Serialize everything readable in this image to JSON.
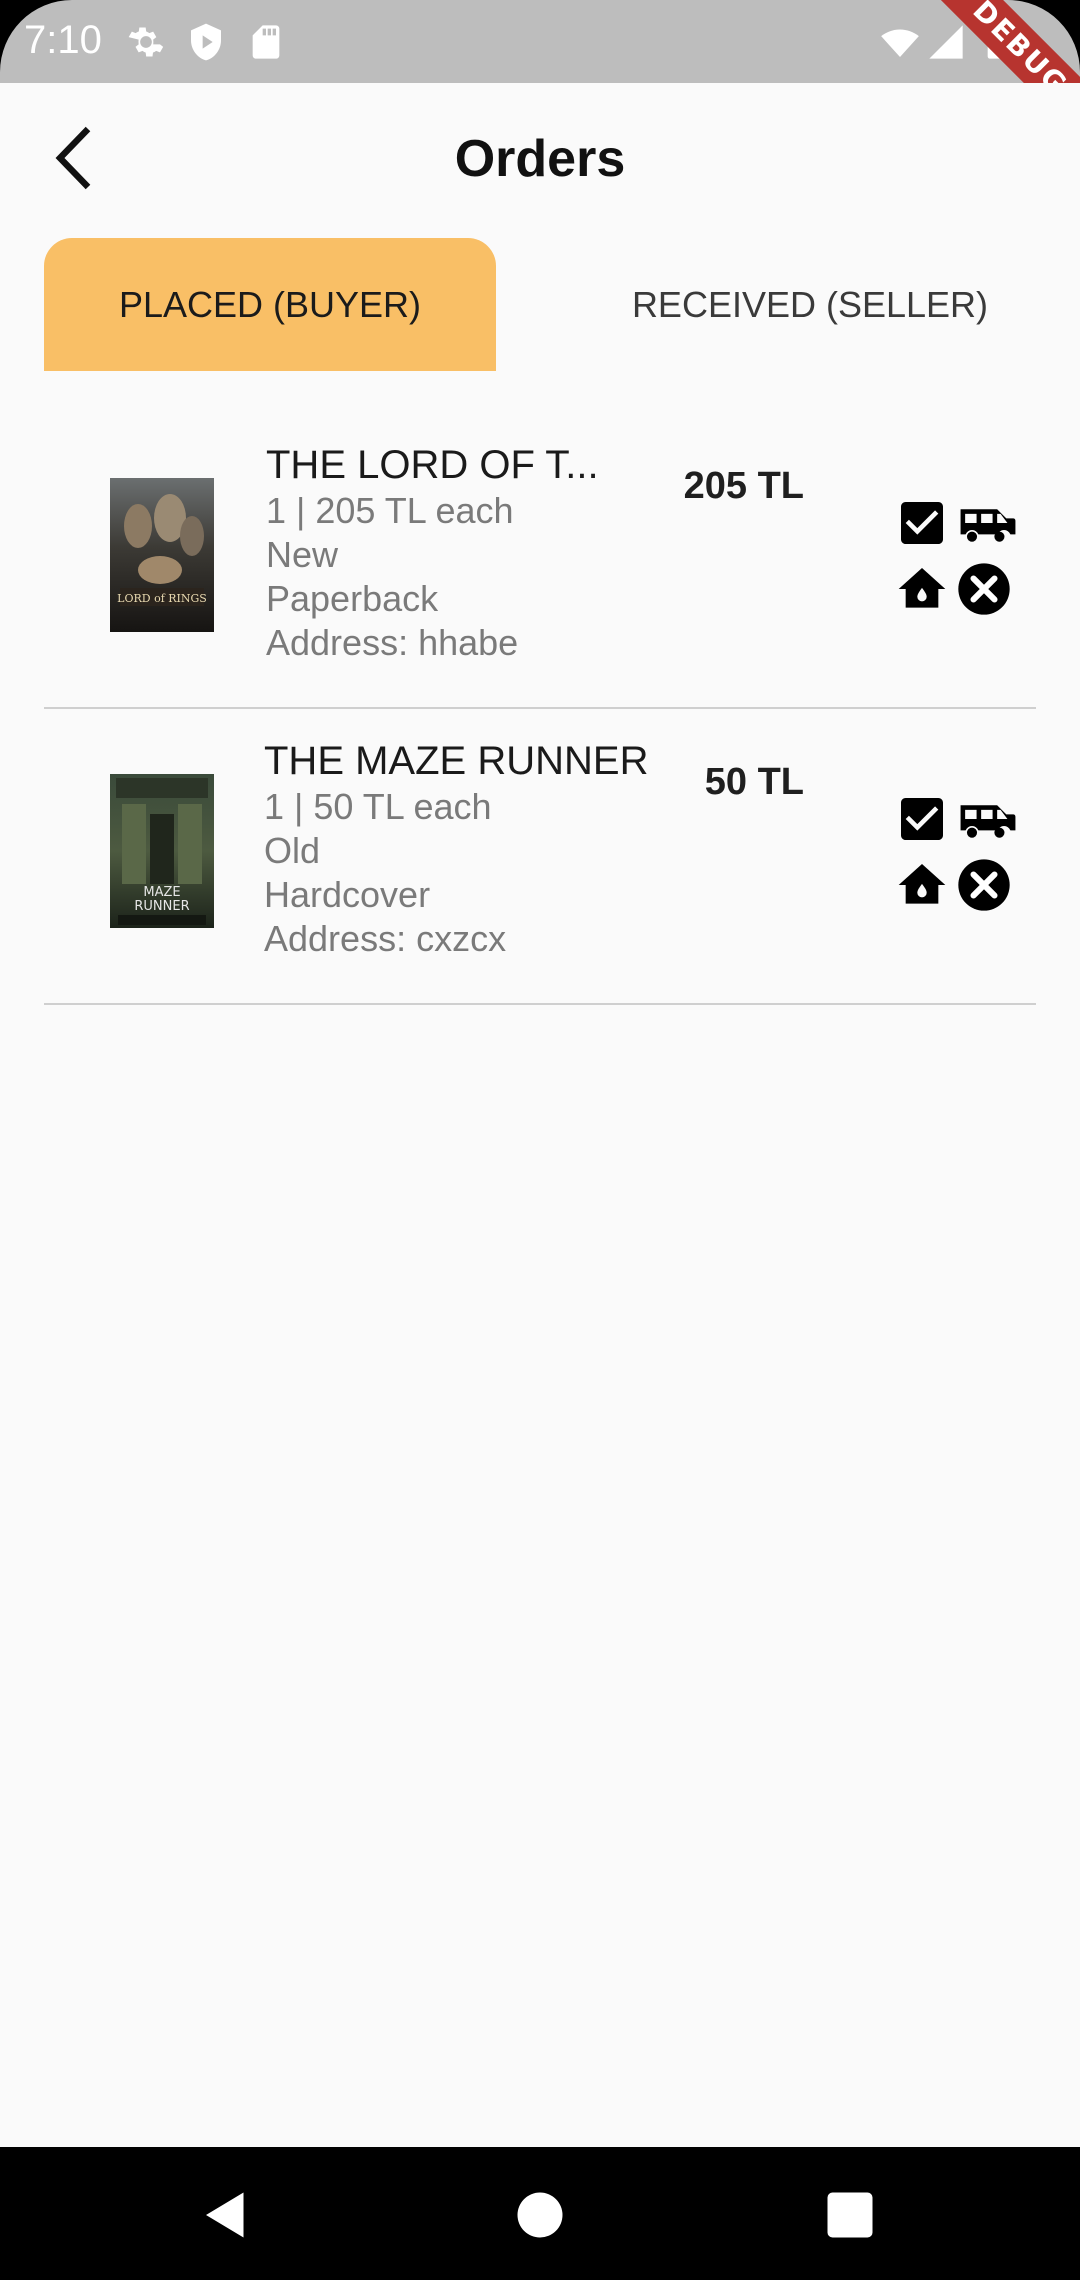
{
  "status_bar": {
    "time": "7:10",
    "icons": [
      "gear-icon",
      "play-shield-icon",
      "sd-card-icon",
      "wifi-icon",
      "signal-icon",
      "battery-icon"
    ],
    "debug_banner": "DEBUG"
  },
  "header": {
    "title": "Orders",
    "back_icon": "back-arrow-icon"
  },
  "tabs": [
    {
      "label": "PLACED (BUYER)",
      "active": true
    },
    {
      "label": "RECEIVED (SELLER)",
      "active": false
    }
  ],
  "colors": {
    "active_tab": "#f9bf66",
    "background": "#fafafa",
    "status_bar": "#bdbdbd",
    "divider": "#cfcfcf"
  },
  "orders": [
    {
      "title": "THE LORD OF T...",
      "quantity_line": "1  |  205 TL each",
      "condition": "New",
      "format": "Paperback",
      "address": "Address: hhabe",
      "total": "205 TL",
      "cover_icon": "book-cover-lord-of-the-rings",
      "actions": [
        "checkbox-icon",
        "delivery-van-icon",
        "home-icon",
        "cancel-icon"
      ]
    },
    {
      "title": "THE MAZE RUNNER",
      "quantity_line": "1  |  50 TL each",
      "condition": "Old",
      "format": "Hardcover",
      "address": "Address: cxzcx",
      "total": "50 TL",
      "cover_icon": "book-cover-maze-runner",
      "actions": [
        "checkbox-icon",
        "delivery-van-icon",
        "home-icon",
        "cancel-icon"
      ]
    }
  ],
  "nav_bar": {
    "buttons": [
      "back-triangle-icon",
      "home-circle-icon",
      "recents-square-icon"
    ]
  }
}
